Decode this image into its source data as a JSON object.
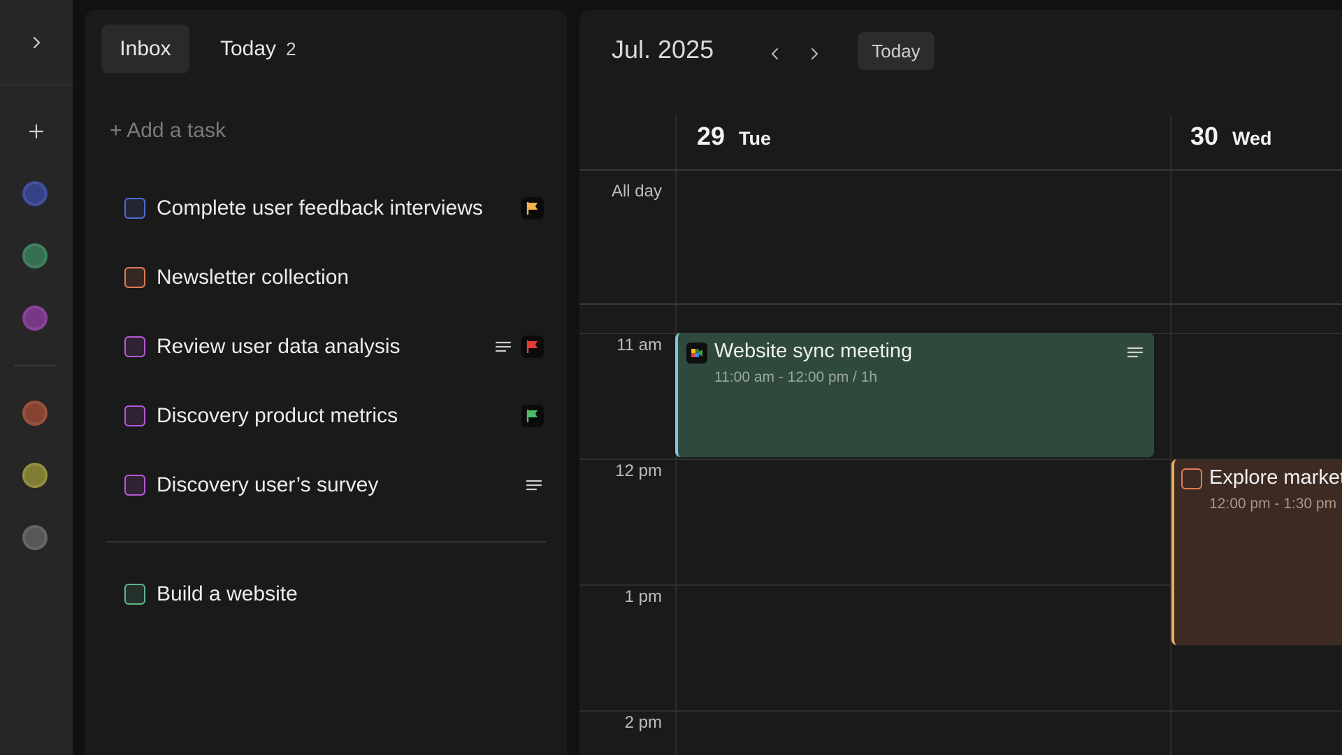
{
  "sidebar": {
    "toggle_icon": "chevron-right-icon",
    "add_icon": "plus-icon",
    "project_colors": [
      "#3f51b5",
      "#3f8f68",
      "#9c44b0",
      "#b3533a",
      "#a9a53a",
      "#6f6f6f"
    ]
  },
  "tasks_panel": {
    "tabs": [
      {
        "label": "Inbox",
        "active": true
      },
      {
        "label": "Today",
        "count": "2",
        "active": false
      }
    ],
    "add_task_placeholder": "+ Add a task",
    "tasks": [
      {
        "title": "Complete user feedback interviews",
        "color": "#4f6ad6",
        "has_notes": false,
        "flag": "#f4b24a"
      },
      {
        "title": "Newsletter collection",
        "color": "#e07a56",
        "has_notes": false,
        "flag": null
      },
      {
        "title": "Review user data analysis",
        "color": "#b558d6",
        "has_notes": true,
        "flag": "#e53935"
      },
      {
        "title": "Discovery product metrics",
        "color": "#b558d6",
        "has_notes": false,
        "flag": "#4cbb6a"
      },
      {
        "title": "Discovery user’s survey",
        "color": "#b558d6",
        "has_notes": true,
        "flag": null
      }
    ],
    "later_tasks": [
      {
        "title": "Build a website",
        "color": "#5fb48a"
      }
    ]
  },
  "calendar": {
    "month_label": "Jul. 2025",
    "today_button": "Today",
    "days": [
      {
        "num": "29",
        "name": "Tue"
      },
      {
        "num": "30",
        "name": "Wed"
      }
    ],
    "all_day_label": "All day",
    "hours": [
      "11 am",
      "12 pm",
      "1 pm",
      "2 pm"
    ],
    "events": [
      {
        "title": "Website sync meeting",
        "time": "11:00 am - 12:00 pm / 1h",
        "color": "#2f4a3d",
        "accent": "#7fc6e6",
        "icon": "google-meet-icon",
        "has_notes": true
      },
      {
        "title": "Explore market",
        "time": "12:00 pm - 1:30 pm",
        "color": "#3c2a23",
        "accent": "#e8b055",
        "has_checkbox": true
      }
    ]
  }
}
